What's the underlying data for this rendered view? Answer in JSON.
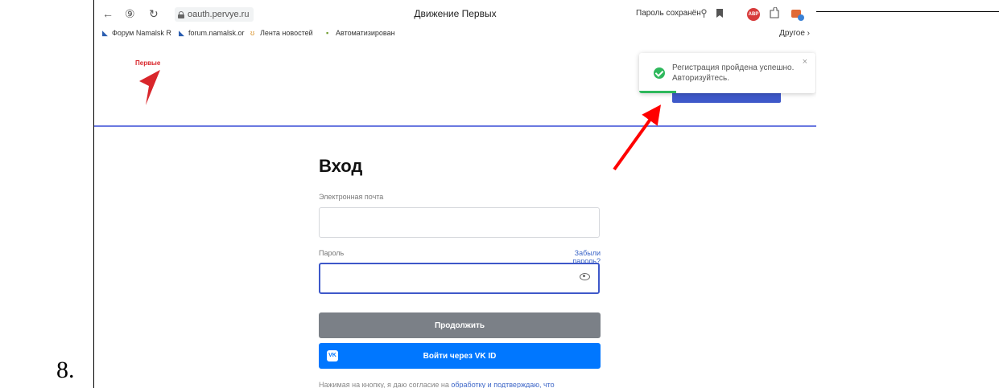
{
  "document": {
    "list_number": "8."
  },
  "browser": {
    "nav_icons": {
      "back": "←",
      "yandex": "⑨",
      "reload": "↻"
    },
    "address_url": "oauth.pervye.ru",
    "tab_title": "Движение Первых",
    "password_status": "Пароль сохранён",
    "extension_badge": "ABP",
    "bookmarks": [
      {
        "label": "Форум Namalsk R",
        "icon": "namalsk-icon"
      },
      {
        "label": "forum.namalsk.or",
        "icon": "namalsk-icon"
      },
      {
        "label": "Лента новостей",
        "icon": "news-icon"
      },
      {
        "label": "Автоматизирован",
        "icon": "app-icon"
      }
    ],
    "other_bookmarks": "Другое"
  },
  "site": {
    "logo_text": "Первые",
    "brand_color": "#d9262b",
    "accent_color": "#3e58c9"
  },
  "toast": {
    "line1": "Регистрация пройдена успешно.",
    "line2": "Авторизуйтесь.",
    "close": "×",
    "status_color": "#2eb85c",
    "progress": 0.21
  },
  "login": {
    "title": "Вход",
    "email_label": "Электронная почта",
    "email_value": "",
    "password_label": "Пароль",
    "password_value": "",
    "forgot_link": "Забыли пароль?",
    "continue_button": "Продолжить",
    "vk_button": "Войти через VK ID",
    "vk_logo": "VK",
    "footer_prefix": "Нажимая на кнопку, я даю согласие на ",
    "footer_link": "обработку и подтверждаю, что"
  },
  "annotation": {
    "arrow_color": "#ff0000"
  }
}
